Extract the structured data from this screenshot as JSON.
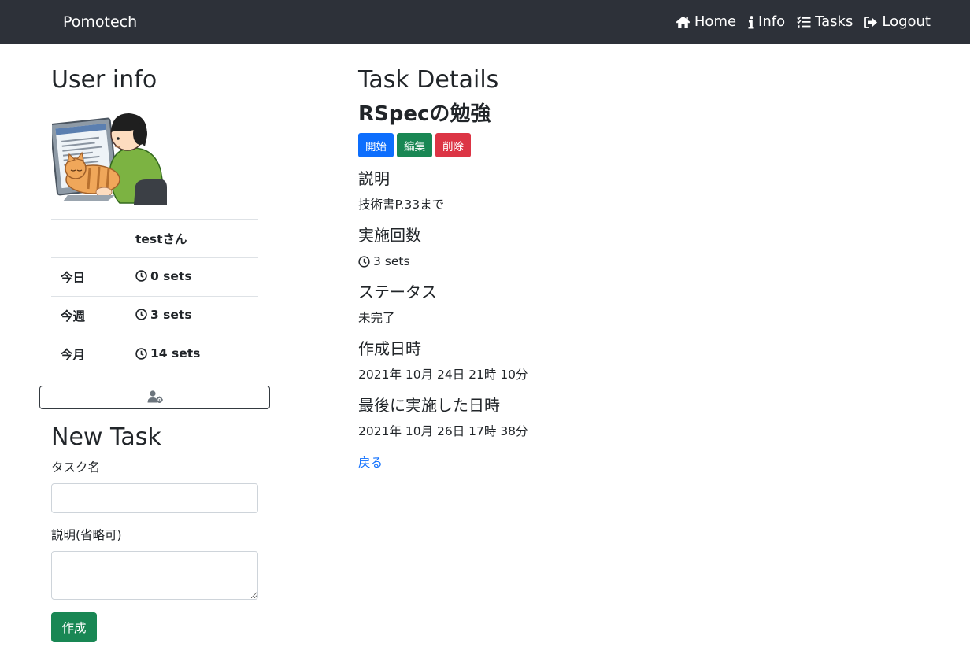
{
  "navbar": {
    "brand": "Pomotech",
    "links": [
      {
        "label": "Home",
        "icon": "home-icon"
      },
      {
        "label": "Info",
        "icon": "info-icon"
      },
      {
        "label": "Tasks",
        "icon": "tasks-icon"
      },
      {
        "label": "Logout",
        "icon": "logout-icon"
      }
    ]
  },
  "user_info": {
    "heading": "User info",
    "avatar": "person-with-cat-at-laptop-illustration",
    "username": "testさん",
    "stats": [
      {
        "label": "今日",
        "value": "0 sets"
      },
      {
        "label": "今週",
        "value": "3 sets"
      },
      {
        "label": "今月",
        "value": "14 sets"
      }
    ],
    "settings_icon": "user-cog-icon"
  },
  "new_task": {
    "heading": "New Task",
    "name_label": "タスク名",
    "name_value": "",
    "description_label": "説明(省略可)",
    "description_value": "",
    "submit_label": "作成"
  },
  "task_details": {
    "heading": "Task Details",
    "task_name": "RSpecの勉強",
    "buttons": {
      "start": "開始",
      "edit": "編集",
      "delete": "削除"
    },
    "description_label": "説明",
    "description_value": "技術書P.33まで",
    "count_label": "実施回数",
    "count_value": "3 sets",
    "status_label": "ステータス",
    "status_value": "未完了",
    "created_label": "作成日時",
    "created_value": "2021年 10月 24日 21時 10分",
    "last_done_label": "最後に実施した日時",
    "last_done_value": "2021年 10月 26日 17時 38分",
    "back_label": "戻る"
  },
  "colors": {
    "navbar_bg": "#2d3139",
    "primary": "#0d6efd",
    "success": "#198754",
    "danger": "#dc3545",
    "text": "#212529"
  }
}
